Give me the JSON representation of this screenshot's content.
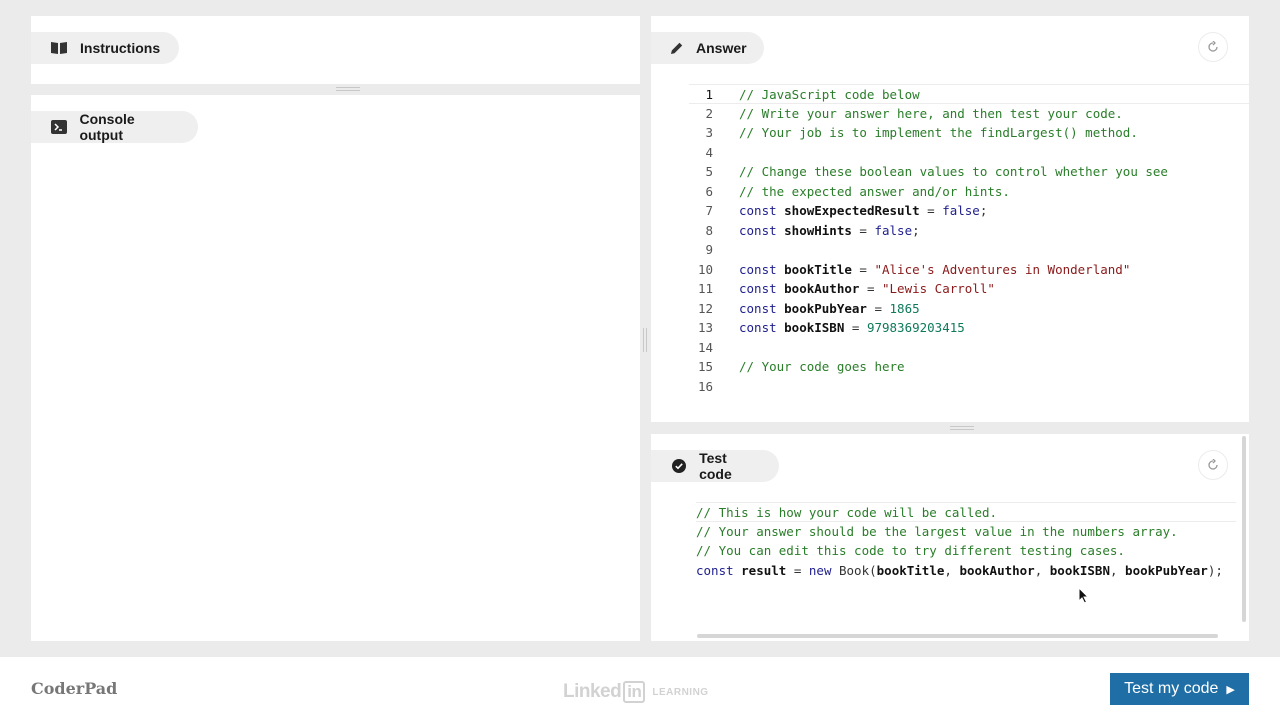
{
  "instructions": {
    "title": "Instructions",
    "icon": "book-icon"
  },
  "console": {
    "title": "Console output",
    "icon": "terminal-icon"
  },
  "answer": {
    "title": "Answer",
    "icon": "pencil-icon",
    "lines": [
      {
        "n": "1",
        "tokens": [
          {
            "t": "// JavaScript code below",
            "c": "comment"
          }
        ]
      },
      {
        "n": "2",
        "tokens": [
          {
            "t": "// Write your answer here, and then test your code.",
            "c": "comment"
          }
        ]
      },
      {
        "n": "3",
        "tokens": [
          {
            "t": "// Your job is to implement the findLargest() method.",
            "c": "comment"
          }
        ]
      },
      {
        "n": "4",
        "tokens": []
      },
      {
        "n": "5",
        "tokens": [
          {
            "t": "// Change these boolean values to control whether you see",
            "c": "comment"
          }
        ]
      },
      {
        "n": "6",
        "tokens": [
          {
            "t": "// the expected answer and/or hints.",
            "c": "comment"
          }
        ]
      },
      {
        "n": "7",
        "tokens": [
          {
            "t": "const ",
            "c": "kw"
          },
          {
            "t": "showExpectedResult",
            "c": "var"
          },
          {
            "t": " = ",
            "c": "fn"
          },
          {
            "t": "false",
            "c": "kw"
          },
          {
            "t": ";",
            "c": "fn"
          }
        ]
      },
      {
        "n": "8",
        "tokens": [
          {
            "t": "const ",
            "c": "kw"
          },
          {
            "t": "showHints",
            "c": "var"
          },
          {
            "t": " = ",
            "c": "fn"
          },
          {
            "t": "false",
            "c": "kw"
          },
          {
            "t": ";",
            "c": "fn"
          }
        ]
      },
      {
        "n": "9",
        "tokens": []
      },
      {
        "n": "10",
        "tokens": [
          {
            "t": "const ",
            "c": "kw"
          },
          {
            "t": "bookTitle",
            "c": "var"
          },
          {
            "t": " = ",
            "c": "fn"
          },
          {
            "t": "\"Alice's Adventures in Wonderland\"",
            "c": "str"
          }
        ]
      },
      {
        "n": "11",
        "tokens": [
          {
            "t": "const ",
            "c": "kw"
          },
          {
            "t": "bookAuthor",
            "c": "var"
          },
          {
            "t": " = ",
            "c": "fn"
          },
          {
            "t": "\"Lewis Carroll\"",
            "c": "str"
          }
        ]
      },
      {
        "n": "12",
        "tokens": [
          {
            "t": "const ",
            "c": "kw"
          },
          {
            "t": "bookPubYear",
            "c": "var"
          },
          {
            "t": " = ",
            "c": "fn"
          },
          {
            "t": "1865",
            "c": "num"
          }
        ]
      },
      {
        "n": "13",
        "tokens": [
          {
            "t": "const ",
            "c": "kw"
          },
          {
            "t": "bookISBN",
            "c": "var"
          },
          {
            "t": " = ",
            "c": "fn"
          },
          {
            "t": "9798369203415",
            "c": "num"
          }
        ]
      },
      {
        "n": "14",
        "tokens": []
      },
      {
        "n": "15",
        "tokens": [
          {
            "t": "// Your code goes here",
            "c": "comment"
          }
        ]
      },
      {
        "n": "16",
        "tokens": []
      }
    ]
  },
  "test": {
    "title": "Test code",
    "icon": "check-circle-icon",
    "lines": [
      {
        "tokens": [
          {
            "t": "// This is how your code will be called.",
            "c": "comment"
          }
        ]
      },
      {
        "tokens": [
          {
            "t": "// Your answer should be the largest value in the numbers array.",
            "c": "comment"
          }
        ]
      },
      {
        "tokens": [
          {
            "t": "// You can edit this code to try different testing cases.",
            "c": "comment"
          }
        ]
      },
      {
        "tokens": [
          {
            "t": "const ",
            "c": "kw"
          },
          {
            "t": "result",
            "c": "var"
          },
          {
            "t": " = ",
            "c": "fn"
          },
          {
            "t": "new ",
            "c": "kw"
          },
          {
            "t": "Book(",
            "c": "fn"
          },
          {
            "t": "bookTitle",
            "c": "var"
          },
          {
            "t": ", ",
            "c": "fn"
          },
          {
            "t": "bookAuthor",
            "c": "var"
          },
          {
            "t": ", ",
            "c": "fn"
          },
          {
            "t": "bookISBN",
            "c": "var"
          },
          {
            "t": ", ",
            "c": "fn"
          },
          {
            "t": "bookPubYear",
            "c": "var"
          },
          {
            "t": ");",
            "c": "fn"
          }
        ]
      }
    ]
  },
  "footer": {
    "brand": "CoderPad",
    "watermark_linked": "Linked",
    "watermark_in": "in",
    "watermark_learning": "LEARNING",
    "test_button": "Test my code",
    "test_button_arrow": "▶"
  }
}
